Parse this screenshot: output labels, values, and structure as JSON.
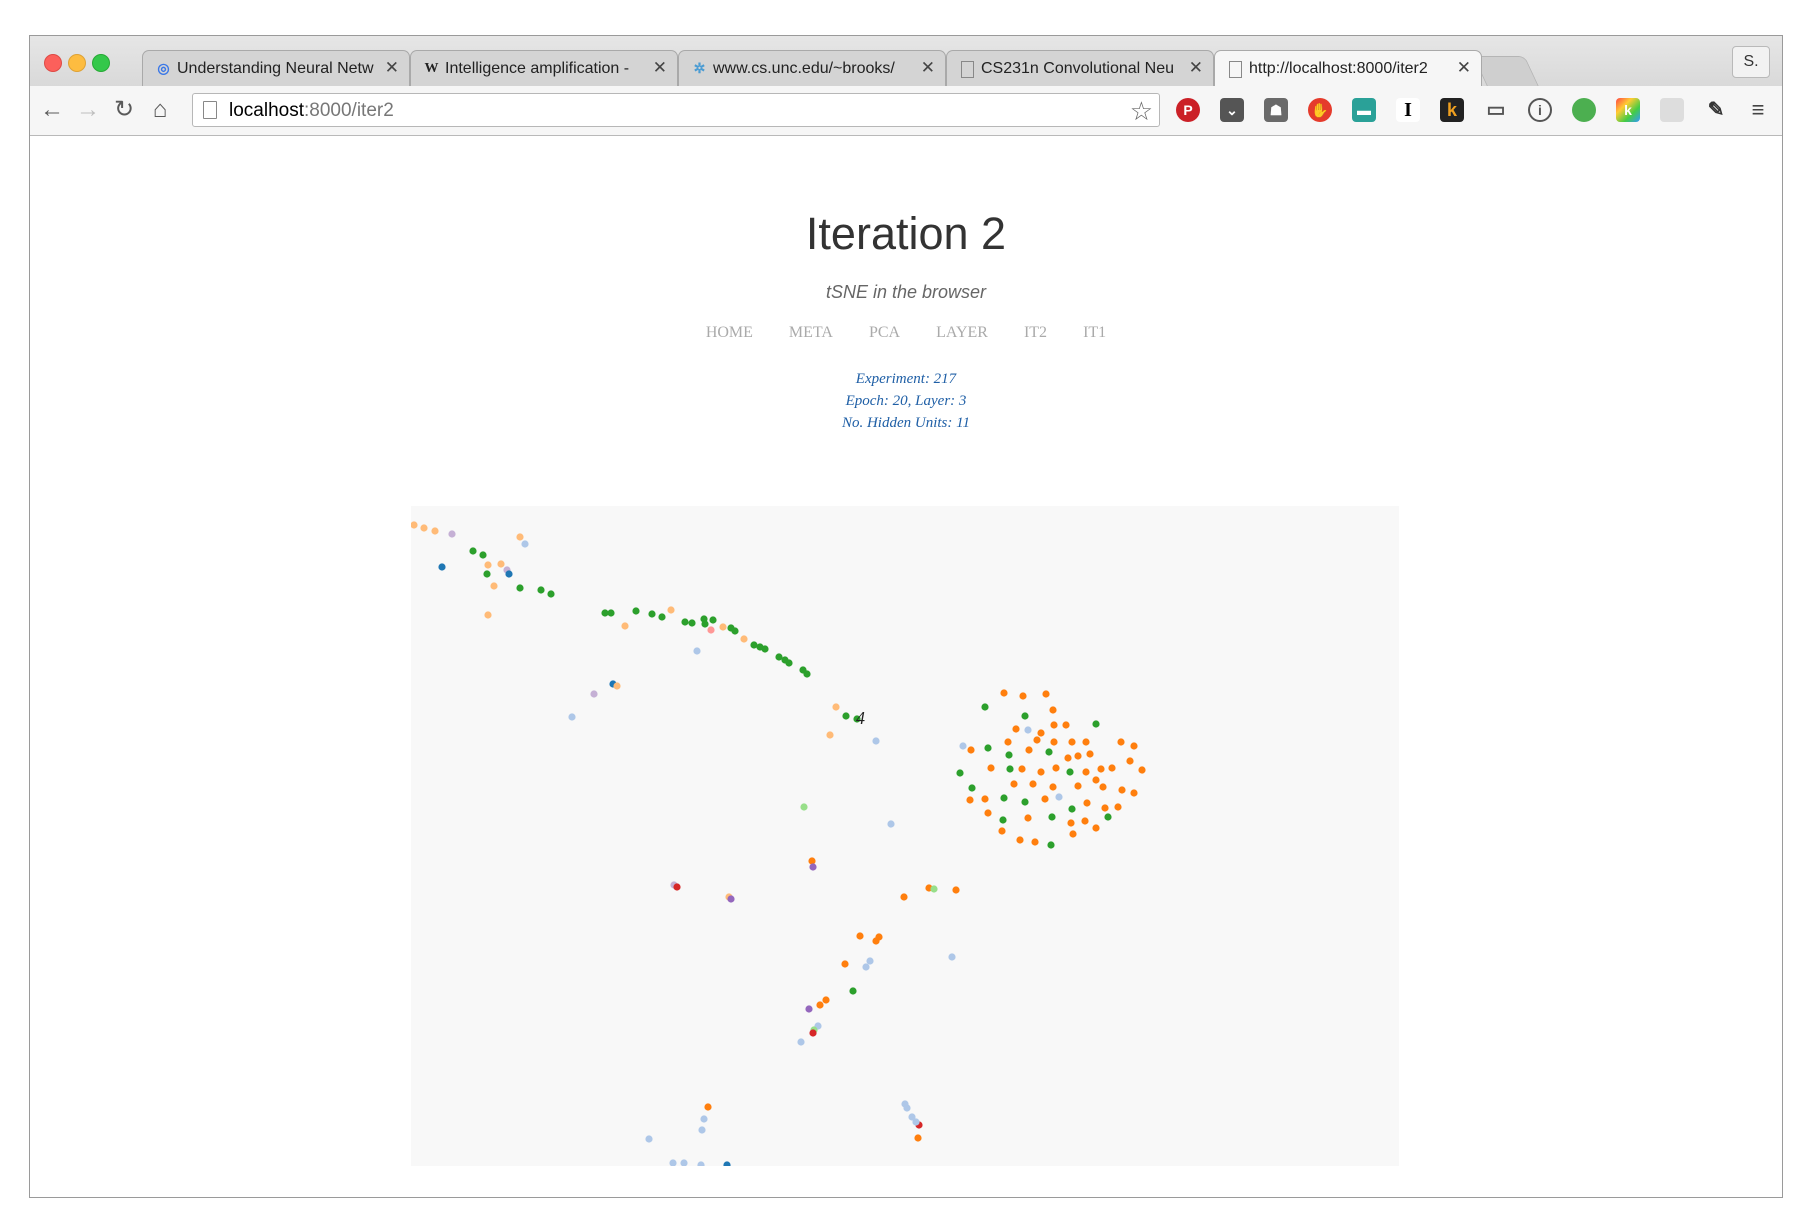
{
  "browser": {
    "tabs": [
      {
        "title": "Understanding Neural Netw",
        "icon": "globe-icon",
        "active": false
      },
      {
        "title": "Intelligence amplification -",
        "icon": "wikipedia-icon",
        "active": false
      },
      {
        "title": "www.cs.unc.edu/~brooks/",
        "icon": "unc-icon",
        "active": false
      },
      {
        "title": "CS231n Convolutional Neu",
        "icon": "page-icon",
        "active": false
      },
      {
        "title": "http://localhost:8000/iter2",
        "icon": "page-icon",
        "active": true
      }
    ],
    "profile_label": "S.",
    "url_host": "localhost",
    "url_path": ":8000/iter2",
    "extensions": [
      "pinterest-icon",
      "pocket-icon",
      "evernote-icon",
      "adblock-icon",
      "stack-icon",
      "instapaper-icon",
      "kindle-icon",
      "cast-icon",
      "onepassword-icon",
      "hangouts-icon",
      "klout-icon",
      "chat-icon",
      "eyedropper-icon",
      "menu-icon"
    ]
  },
  "page": {
    "title": "Iteration 2",
    "subtitle": "tSNE in the browser",
    "nav": [
      "HOME",
      "META",
      "PCA",
      "LAYER",
      "IT2",
      "IT1"
    ],
    "experiment": "Experiment: 217",
    "epoch_layer": "Epoch: 20, Layer: 3",
    "hidden_units": "No. Hidden Units: 11"
  },
  "chart_data": {
    "type": "scatter",
    "annotation": "4",
    "palette": {
      "O": "#ff7f0e",
      "o": "#ffbb78",
      "G": "#2ca02c",
      "g": "#98df8a",
      "B": "#1f77b4",
      "b": "#aec7e8",
      "P": "#9467bd",
      "p": "#c5b0d5",
      "R": "#d62728",
      "r": "#ff9896"
    },
    "points": [
      [
        3,
        19,
        "o"
      ],
      [
        13,
        22,
        "o"
      ],
      [
        24,
        25,
        "o"
      ],
      [
        41,
        28,
        "p"
      ],
      [
        109,
        31,
        "o"
      ],
      [
        114,
        38,
        "b"
      ],
      [
        31,
        61,
        "B"
      ],
      [
        62,
        45,
        "G"
      ],
      [
        72,
        49,
        "G"
      ],
      [
        77,
        59,
        "o"
      ],
      [
        76,
        68,
        "G"
      ],
      [
        90,
        58,
        "o"
      ],
      [
        96,
        64,
        "p"
      ],
      [
        98,
        68,
        "B"
      ],
      [
        83,
        80,
        "o"
      ],
      [
        109,
        82,
        "G"
      ],
      [
        130,
        84,
        "G"
      ],
      [
        140,
        88,
        "G"
      ],
      [
        77,
        109,
        "o"
      ],
      [
        194,
        107,
        "G"
      ],
      [
        200,
        107,
        "G"
      ],
      [
        225,
        105,
        "G"
      ],
      [
        241,
        108,
        "G"
      ],
      [
        251,
        111,
        "G"
      ],
      [
        260,
        104,
        "o"
      ],
      [
        214,
        120,
        "o"
      ],
      [
        274,
        116,
        "G"
      ],
      [
        281,
        117,
        "G"
      ],
      [
        293,
        113,
        "G"
      ],
      [
        294,
        118,
        "G"
      ],
      [
        302,
        114,
        "G"
      ],
      [
        300,
        124,
        "r"
      ],
      [
        312,
        121,
        "o"
      ],
      [
        320,
        122,
        "G"
      ],
      [
        324,
        125,
        "G"
      ],
      [
        333,
        133,
        "o"
      ],
      [
        343,
        139,
        "G"
      ],
      [
        349,
        141,
        "G"
      ],
      [
        354,
        143,
        "G"
      ],
      [
        368,
        151,
        "G"
      ],
      [
        374,
        154,
        "G"
      ],
      [
        378,
        157,
        "G"
      ],
      [
        392,
        164,
        "G"
      ],
      [
        396,
        168,
        "G"
      ],
      [
        286,
        145,
        "b"
      ],
      [
        202,
        178,
        "B"
      ],
      [
        206,
        180,
        "o"
      ],
      [
        183,
        188,
        "p"
      ],
      [
        161,
        211,
        "b"
      ],
      [
        425,
        201,
        "o"
      ],
      [
        435,
        210,
        "G"
      ],
      [
        446,
        213,
        "G"
      ],
      [
        419,
        229,
        "o"
      ],
      [
        465,
        235,
        "b"
      ],
      [
        393,
        301,
        "g"
      ],
      [
        480,
        318,
        "b"
      ],
      [
        401,
        355,
        "O"
      ],
      [
        402,
        361,
        "P"
      ],
      [
        263,
        379,
        "p"
      ],
      [
        266,
        381,
        "R"
      ],
      [
        318,
        391,
        "o"
      ],
      [
        320,
        393,
        "P"
      ],
      [
        493,
        391,
        "O"
      ],
      [
        518,
        382,
        "O"
      ],
      [
        523,
        383,
        "g"
      ],
      [
        545,
        384,
        "O"
      ],
      [
        449,
        430,
        "O"
      ],
      [
        465,
        435,
        "O"
      ],
      [
        468,
        431,
        "O"
      ],
      [
        434,
        458,
        "O"
      ],
      [
        459,
        455,
        "b"
      ],
      [
        455,
        461,
        "b"
      ],
      [
        541,
        451,
        "b"
      ],
      [
        442,
        485,
        "G"
      ],
      [
        415,
        494,
        "O"
      ],
      [
        409,
        499,
        "O"
      ],
      [
        398,
        503,
        "P"
      ],
      [
        407,
        520,
        "b"
      ],
      [
        403,
        524,
        "g"
      ],
      [
        402,
        527,
        "R"
      ],
      [
        390,
        536,
        "b"
      ],
      [
        494,
        598,
        "b"
      ],
      [
        496,
        602,
        "b"
      ],
      [
        501,
        611,
        "b"
      ],
      [
        508,
        619,
        "R"
      ],
      [
        505,
        616,
        "b"
      ],
      [
        507,
        632,
        "O"
      ],
      [
        297,
        601,
        "O"
      ],
      [
        293,
        613,
        "b"
      ],
      [
        291,
        624,
        "b"
      ],
      [
        238,
        633,
        "b"
      ],
      [
        262,
        657,
        "b"
      ],
      [
        273,
        657,
        "b"
      ],
      [
        290,
        659,
        "b"
      ],
      [
        316,
        659,
        "B"
      ],
      [
        593,
        187,
        "O"
      ],
      [
        612,
        190,
        "O"
      ],
      [
        635,
        188,
        "O"
      ],
      [
        574,
        201,
        "G"
      ],
      [
        614,
        210,
        "G"
      ],
      [
        642,
        204,
        "O"
      ],
      [
        643,
        219,
        "O"
      ],
      [
        617,
        224,
        "b"
      ],
      [
        630,
        227,
        "O"
      ],
      [
        605,
        223,
        "O"
      ],
      [
        655,
        219,
        "O"
      ],
      [
        685,
        218,
        "G"
      ],
      [
        675,
        236,
        "O"
      ],
      [
        661,
        236,
        "O"
      ],
      [
        643,
        236,
        "O"
      ],
      [
        626,
        234,
        "O"
      ],
      [
        597,
        236,
        "O"
      ],
      [
        577,
        242,
        "G"
      ],
      [
        560,
        244,
        "O"
      ],
      [
        552,
        240,
        "b"
      ],
      [
        657,
        252,
        "O"
      ],
      [
        667,
        250,
        "O"
      ],
      [
        679,
        248,
        "O"
      ],
      [
        598,
        249,
        "G"
      ],
      [
        618,
        244,
        "O"
      ],
      [
        638,
        246,
        "G"
      ],
      [
        580,
        262,
        "O"
      ],
      [
        599,
        263,
        "G"
      ],
      [
        611,
        263,
        "O"
      ],
      [
        630,
        266,
        "O"
      ],
      [
        645,
        262,
        "O"
      ],
      [
        659,
        266,
        "G"
      ],
      [
        675,
        266,
        "O"
      ],
      [
        690,
        263,
        "O"
      ],
      [
        603,
        278,
        "O"
      ],
      [
        622,
        278,
        "O"
      ],
      [
        642,
        281,
        "O"
      ],
      [
        667,
        280,
        "O"
      ],
      [
        685,
        274,
        "O"
      ],
      [
        692,
        281,
        "O"
      ],
      [
        549,
        267,
        "G"
      ],
      [
        561,
        282,
        "G"
      ],
      [
        559,
        294,
        "O"
      ],
      [
        574,
        293,
        "O"
      ],
      [
        593,
        292,
        "G"
      ],
      [
        614,
        296,
        "G"
      ],
      [
        634,
        293,
        "O"
      ],
      [
        648,
        291,
        "b"
      ],
      [
        661,
        303,
        "G"
      ],
      [
        676,
        297,
        "O"
      ],
      [
        694,
        302,
        "O"
      ],
      [
        707,
        301,
        "O"
      ],
      [
        711,
        284,
        "O"
      ],
      [
        697,
        311,
        "G"
      ],
      [
        577,
        307,
        "O"
      ],
      [
        592,
        314,
        "G"
      ],
      [
        617,
        312,
        "O"
      ],
      [
        641,
        311,
        "G"
      ],
      [
        660,
        317,
        "O"
      ],
      [
        674,
        315,
        "O"
      ],
      [
        591,
        325,
        "O"
      ],
      [
        609,
        334,
        "O"
      ],
      [
        624,
        336,
        "O"
      ],
      [
        640,
        339,
        "G"
      ],
      [
        662,
        328,
        "O"
      ],
      [
        685,
        322,
        "O"
      ],
      [
        723,
        287,
        "O"
      ],
      [
        701,
        262,
        "O"
      ],
      [
        719,
        255,
        "O"
      ],
      [
        731,
        264,
        "O"
      ],
      [
        723,
        240,
        "O"
      ],
      [
        710,
        236,
        "O"
      ]
    ]
  }
}
